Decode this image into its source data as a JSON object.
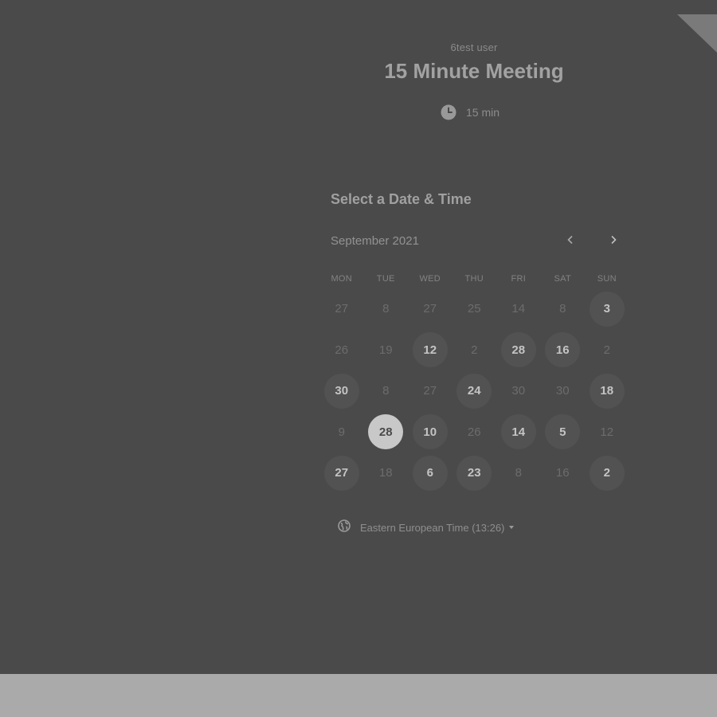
{
  "owner_name": "6test user",
  "event": {
    "title": "15 Minute Meeting",
    "duration": "15 min",
    "duration_icon": "clock-icon"
  },
  "scheduler": {
    "title": "Select a Date & Time",
    "month": "September 2021",
    "prev_icon": "chevron-left-icon",
    "next_icon": "chevron-right-icon",
    "weekdays": [
      "MON",
      "TUE",
      "WED",
      "THU",
      "FRI",
      "SAT",
      "SUN"
    ],
    "weeks": [
      [
        {
          "label": "27",
          "state": "unavailable"
        },
        {
          "label": "8",
          "state": "unavailable"
        },
        {
          "label": "27",
          "state": "unavailable"
        },
        {
          "label": "25",
          "state": "unavailable"
        },
        {
          "label": "14",
          "state": "unavailable"
        },
        {
          "label": "8",
          "state": "unavailable"
        },
        {
          "label": "3",
          "state": "available"
        }
      ],
      [
        {
          "label": "26",
          "state": "unavailable"
        },
        {
          "label": "19",
          "state": "unavailable"
        },
        {
          "label": "12",
          "state": "available"
        },
        {
          "label": "2",
          "state": "unavailable"
        },
        {
          "label": "28",
          "state": "available"
        },
        {
          "label": "16",
          "state": "available"
        },
        {
          "label": "2",
          "state": "unavailable"
        }
      ],
      [
        {
          "label": "30",
          "state": "available"
        },
        {
          "label": "8",
          "state": "unavailable"
        },
        {
          "label": "27",
          "state": "unavailable"
        },
        {
          "label": "24",
          "state": "available"
        },
        {
          "label": "30",
          "state": "unavailable"
        },
        {
          "label": "30",
          "state": "unavailable"
        },
        {
          "label": "18",
          "state": "available"
        }
      ],
      [
        {
          "label": "9",
          "state": "unavailable"
        },
        {
          "label": "28",
          "state": "selected"
        },
        {
          "label": "10",
          "state": "available"
        },
        {
          "label": "26",
          "state": "unavailable"
        },
        {
          "label": "14",
          "state": "available"
        },
        {
          "label": "5",
          "state": "available"
        },
        {
          "label": "12",
          "state": "unavailable"
        }
      ],
      [
        {
          "label": "27",
          "state": "available"
        },
        {
          "label": "18",
          "state": "unavailable"
        },
        {
          "label": "6",
          "state": "available"
        },
        {
          "label": "23",
          "state": "available"
        },
        {
          "label": "8",
          "state": "unavailable"
        },
        {
          "label": "16",
          "state": "unavailable"
        },
        {
          "label": "2",
          "state": "available"
        }
      ]
    ],
    "timezone": "Eastern European Time (13:26)",
    "timezone_icon": "globe-icon"
  },
  "colors": {
    "background": "#4a4a4a",
    "bottom_bar": "#aaaaaa",
    "selected_day": "#c8c8c8",
    "available_day": "#525252"
  }
}
